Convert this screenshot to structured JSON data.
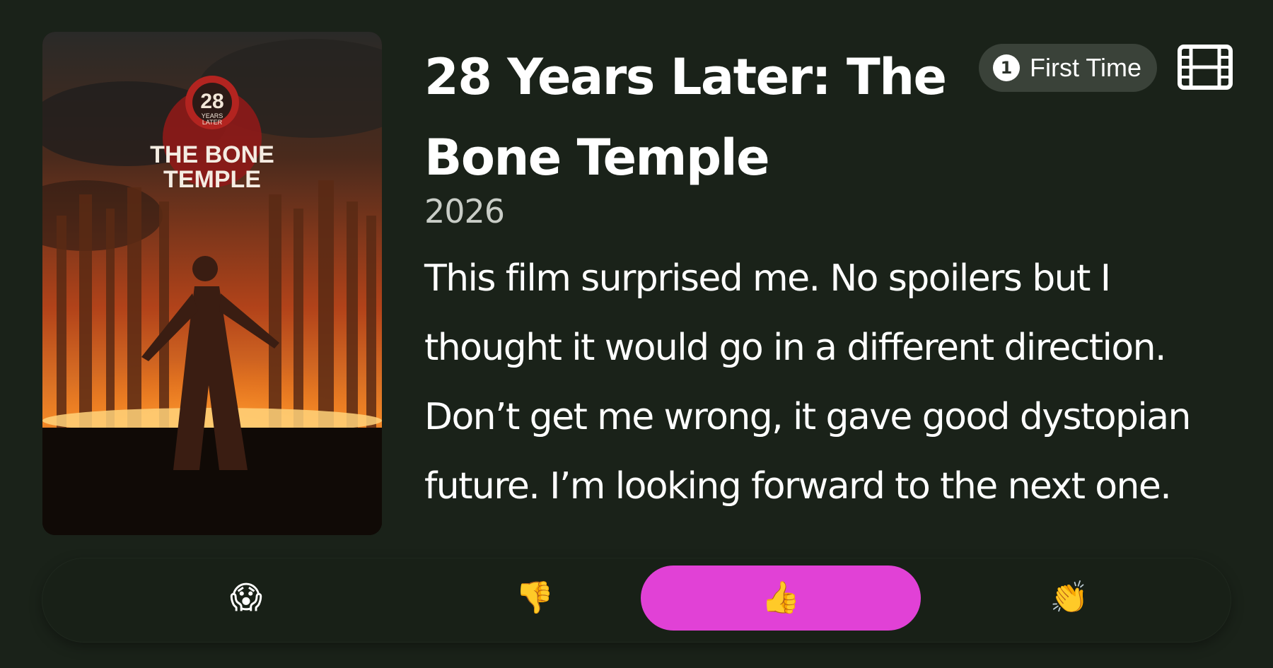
{
  "movie": {
    "title_lines": [
      "28 Years Later: The",
      "Bone Temple"
    ],
    "year": "2026",
    "poster": {
      "logo_number": "28",
      "logo_small_line1": "YEARS",
      "logo_small_line2": "LATER",
      "logo_line1": "THE BONE",
      "logo_line2": "TEMPLE"
    }
  },
  "review": {
    "lines": [
      "This film surprised me. No spoilers but I",
      "thought it would go in a different direction.",
      "Don’t get me wrong, it gave good dystopian",
      "future. I’m looking forward to the next one."
    ]
  },
  "badge": {
    "number": "1",
    "label": "First Time"
  },
  "icons": {
    "film": "film-strip-icon"
  },
  "reactions": [
    {
      "emoji": "😱",
      "name": "scream",
      "selected": false
    },
    {
      "emoji": "👎",
      "name": "thumbs-down",
      "selected": false
    },
    {
      "emoji": "👍",
      "name": "thumbs-up",
      "selected": true
    },
    {
      "emoji": "👏",
      "name": "clap",
      "selected": false
    }
  ],
  "colors": {
    "background": "#1a2219",
    "accent_selected": "#e141d6",
    "badge_bg": "#3a4239"
  }
}
